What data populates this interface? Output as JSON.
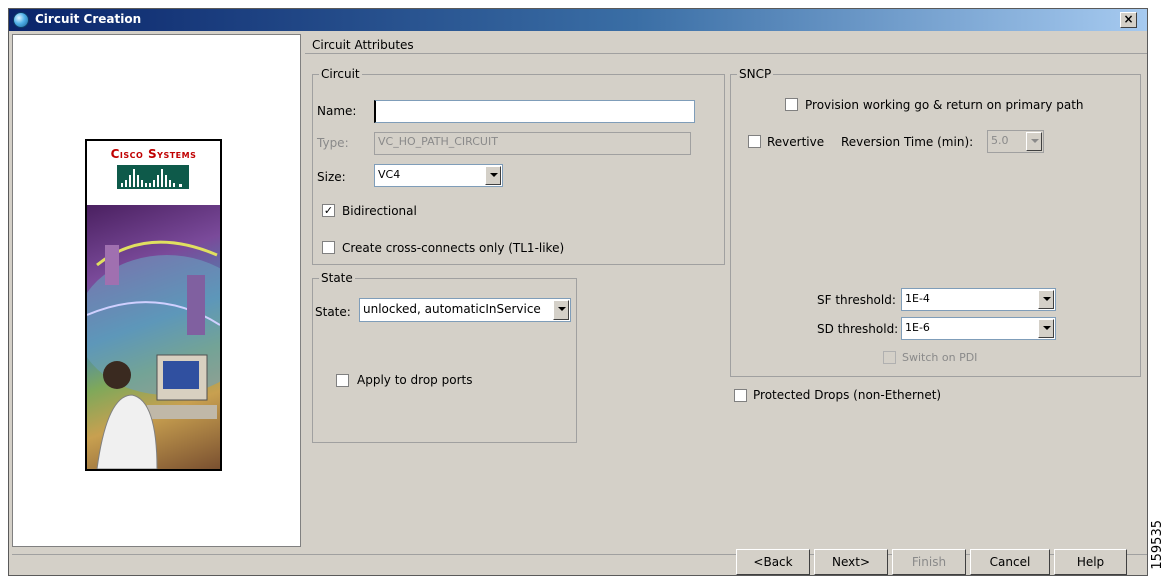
{
  "window": {
    "title": "Circuit Creation",
    "close_glyph": "×"
  },
  "brand": {
    "logo_text": "Cisco Systems"
  },
  "header": {
    "title": "Circuit Attributes"
  },
  "circuit": {
    "group_label": "Circuit",
    "name_label": "Name:",
    "name_value": "",
    "type_label": "Type:",
    "type_value": "VC_HO_PATH_CIRCUIT",
    "size_label": "Size:",
    "size_value": "VC4",
    "bidirectional_label": "Bidirectional",
    "bidirectional_checked": true,
    "cross_connects_label": "Create cross-connects only (TL1-like)",
    "cross_connects_checked": false
  },
  "state": {
    "group_label": "State",
    "state_label": "State:",
    "state_value": "unlocked, automaticInService",
    "apply_drop_label": "Apply to drop ports"
  },
  "sncp": {
    "group_label": "SNCP",
    "provision_label": "Provision working go & return on primary path",
    "revertive_label": "Revertive",
    "reversion_label": "Reversion Time (min):",
    "reversion_value": "5.0",
    "sf_label": "SF threshold:",
    "sf_value": "1E-4",
    "sd_label": "SD threshold:",
    "sd_value": "1E-6",
    "switch_pdi_label": "Switch on PDI"
  },
  "protected_drops_label": "Protected Drops (non-Ethernet)",
  "buttons": {
    "back": "<Back",
    "next": "Next>",
    "finish": "Finish",
    "cancel": "Cancel",
    "help": "Help"
  },
  "figure_number": "159535"
}
